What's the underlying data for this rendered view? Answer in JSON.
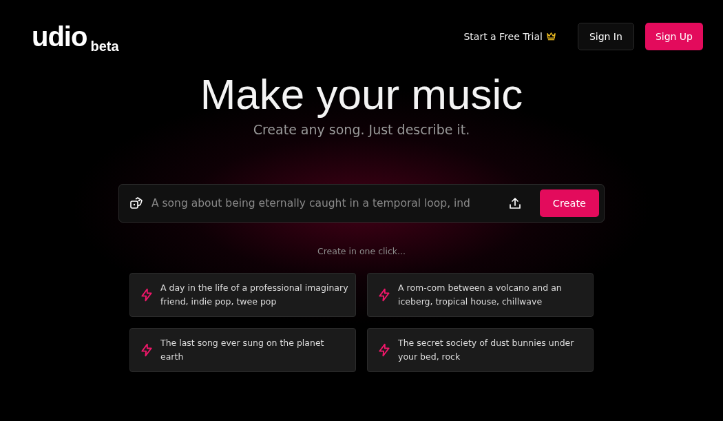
{
  "header": {
    "logo": {
      "wordmark": "udio",
      "badge": "beta"
    },
    "trial_link": "Start a Free Trial",
    "sign_in": "Sign In",
    "sign_up": "Sign Up"
  },
  "hero": {
    "title": "Make your music",
    "subtitle": "Create any song. Just describe it."
  },
  "prompt": {
    "placeholder": "A song about being eternally caught in a temporal loop, ind",
    "create_button": "Create"
  },
  "suggestions_label": "Create in one click...",
  "suggestions": [
    {
      "text": "A day in the life of a professional imaginary friend, indie pop, twee pop"
    },
    {
      "text": "A rom-com between a volcano and an iceberg, tropical house, chillwave"
    },
    {
      "text": "The last song ever sung on the planet earth"
    },
    {
      "text": "The secret society of dust bunnies under your bed, rock"
    }
  ]
}
